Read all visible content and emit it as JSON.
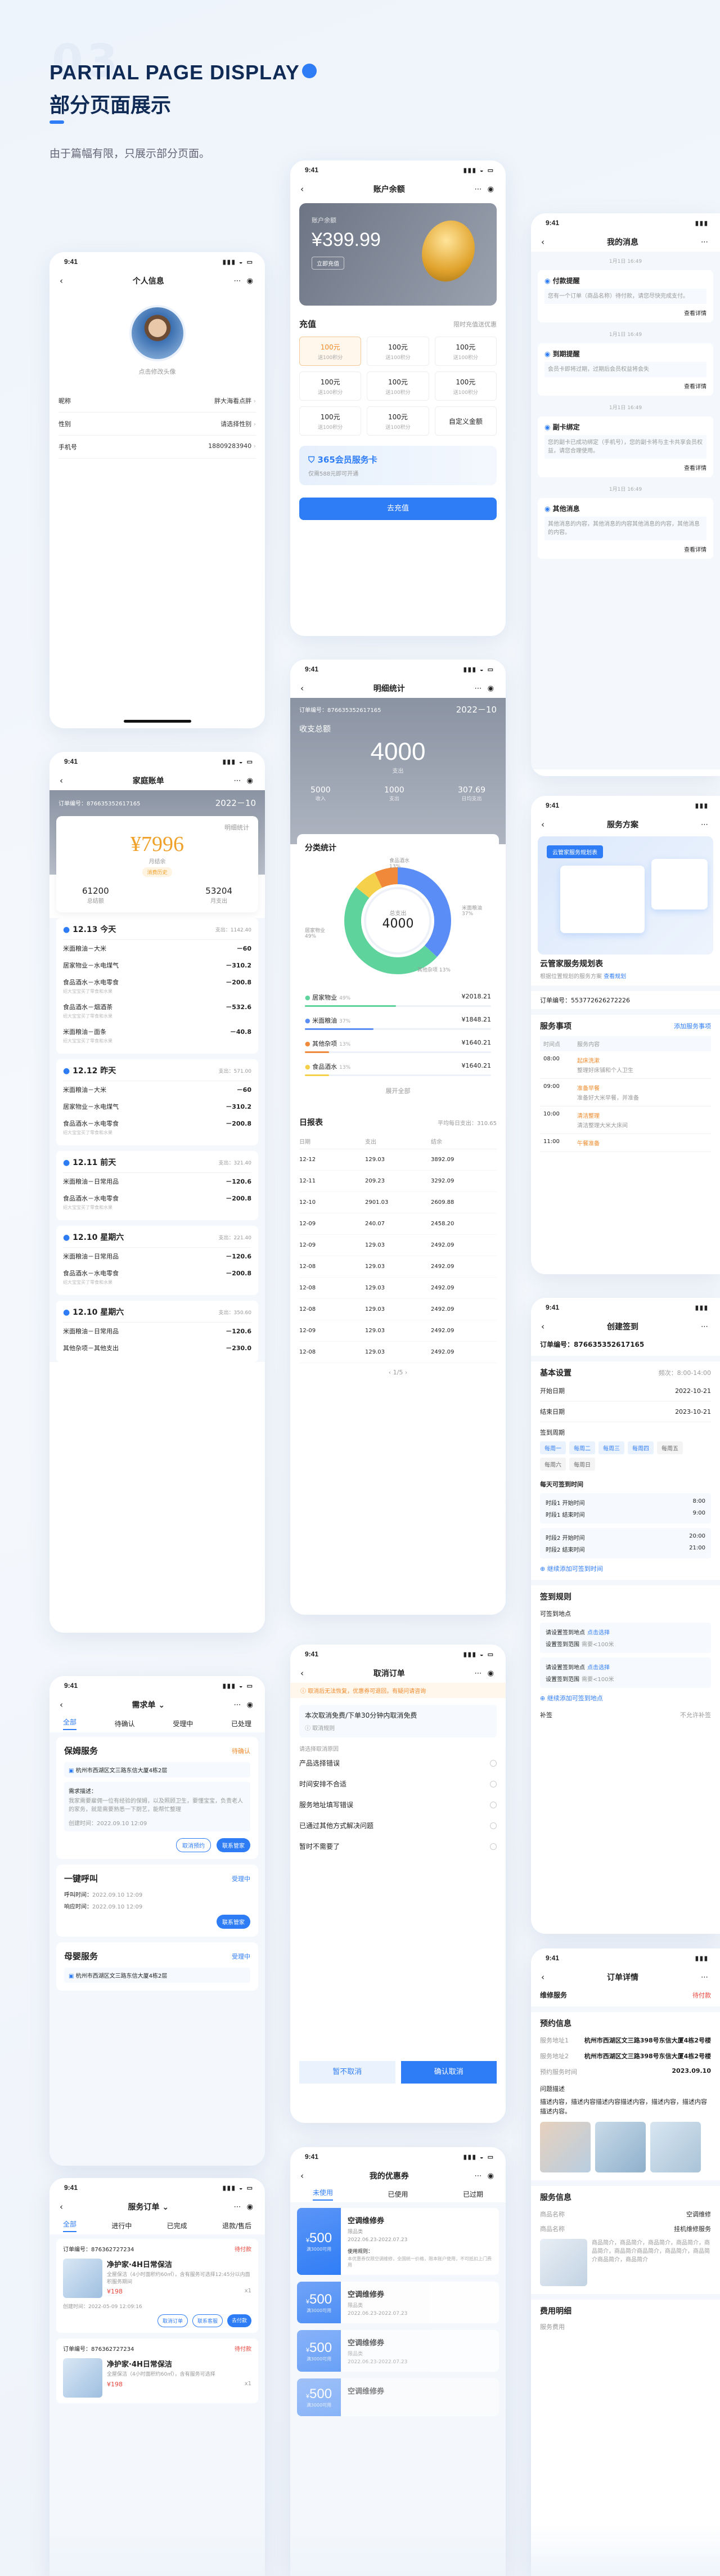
{
  "header": {
    "ghost": "03",
    "title_en": "PARTIAL PAGE DISPLAY",
    "title_cn": "部分页面展示",
    "desc": "由于篇幅有限，只展示部分页面。"
  },
  "status_time": "9:41",
  "profile": {
    "title": "个人信息",
    "avatar_hint": "点击修改头像",
    "rows": [
      {
        "label": "昵称",
        "value": "胖大海看点胖"
      },
      {
        "label": "性别",
        "value": "请选择性别"
      },
      {
        "label": "手机号",
        "value": "18809283940"
      }
    ]
  },
  "balance": {
    "title": "账户余额",
    "card_label": "账户余额",
    "amount": "¥399.99",
    "card_btn": "立即充值",
    "recharge_title": "充值",
    "recharge_hint": "限时充值送优惠",
    "options": [
      {
        "a": "100元",
        "b": "送100积分"
      },
      {
        "a": "100元",
        "b": "送100积分"
      },
      {
        "a": "100元",
        "b": "送100积分"
      },
      {
        "a": "100元",
        "b": "送100积分"
      },
      {
        "a": "100元",
        "b": "送100积分"
      },
      {
        "a": "100元",
        "b": "送100积分"
      },
      {
        "a": "100元",
        "b": "送100积分"
      },
      {
        "a": "100元",
        "b": "送100积分"
      },
      {
        "a": "自定义金额",
        "b": ""
      }
    ],
    "vip_title": "365会员服务卡",
    "vip_sub": "仅需588元即可开通",
    "submit": "去充值"
  },
  "messages": {
    "title": "我的消息",
    "items": [
      {
        "time": "1月1日 16:49",
        "title": "付款提醒",
        "body": "您有一个订单（商品名称）待付款，请您尽快完成支付。",
        "link": "查看详情"
      },
      {
        "time": "1月1日 16:49",
        "title": "到期提醒",
        "body": "会员卡即将过期，过期后会员权益将会失",
        "link": "查看详情"
      },
      {
        "time": "1月1日 16:49",
        "title": "副卡绑定",
        "body": "您的副卡已成功绑定（手机号），您的副卡将与主卡共享会员权益，请您合理使用。",
        "link": "查看详情"
      },
      {
        "time": "1月1日 16:49",
        "title": "其他消息",
        "body": "其他消息的内容，其他消息的内容其他消息的内容，其他消息的内容。",
        "link": "查看详情"
      }
    ]
  },
  "stats": {
    "title": "明细统计",
    "order_no": "订单编号：876635352617165",
    "month": "2022－10",
    "total_label": "收支总额",
    "total": "4000",
    "total_unit": "支出",
    "sub": [
      {
        "v": "5000",
        "l": "收入"
      },
      {
        "v": "1000",
        "l": "支出"
      },
      {
        "v": "307.69",
        "l": "日均支出"
      }
    ],
    "cat_title": "分类统计",
    "donut_center": "4000",
    "donut_center_label": "总支出",
    "donut_labels": [
      "食品酒水 13%",
      "米面粮油 37%",
      "其他杂项 13%",
      "居家物业 49%"
    ],
    "cats": [
      {
        "name": "居家物业",
        "pct": "49%",
        "amt": "¥2018.21"
      },
      {
        "name": "米面粮油",
        "pct": "37%",
        "amt": "¥1848.21"
      },
      {
        "name": "其他杂项",
        "pct": "13%",
        "amt": "¥1640.21"
      },
      {
        "name": "食品酒水",
        "pct": "13%",
        "amt": "¥1640.21"
      }
    ],
    "expand": "展开全部",
    "daily_title": "日报表",
    "daily_hint": "平均每日支出：310.65",
    "daily_head": [
      "日期",
      "支出",
      "结余"
    ],
    "daily": [
      [
        "12-12",
        "129.03",
        "3892.09"
      ],
      [
        "12-11",
        "209.23",
        "3292.09"
      ],
      [
        "12-10",
        "2901.03",
        "2609.88"
      ],
      [
        "12-09",
        "240.07",
        "2458.20"
      ],
      [
        "12-09",
        "129.03",
        "2492.09"
      ],
      [
        "12-08",
        "129.03",
        "2492.09"
      ],
      [
        "12-08",
        "129.03",
        "2492.09"
      ],
      [
        "12-08",
        "129.03",
        "2492.09"
      ],
      [
        "12-09",
        "129.03",
        "2492.09"
      ],
      [
        "12-08",
        "129.03",
        "2492.09"
      ]
    ],
    "pager": "1/5"
  },
  "service": {
    "title": "服务方案",
    "banner_title": "云管家服务规划表",
    "plan_title": "云管家服务规划表",
    "plan_sub": "根据位置规划的服务方案",
    "plan_link": "查看规划",
    "order": "订单编号：553772626272226",
    "items_title": "服务事项",
    "add": "添加服务事项",
    "head": [
      "时间点",
      "服务内容"
    ],
    "rows": [
      {
        "t": "08:00",
        "d": "起床洗漱",
        "s": "整理好床铺和个人卫生"
      },
      {
        "t": "09:00",
        "d": "准备早餐",
        "s": "准备好大米早餐，并准备"
      },
      {
        "t": "10:00",
        "d": "清洁整理",
        "s": "清洁整理大米大床间"
      },
      {
        "t": "11:00",
        "d": "午餐准备",
        "s": ""
      }
    ]
  },
  "ledger": {
    "title": "家庭账单",
    "order_no": "订单编号：876635352617165",
    "month": "2022－10",
    "detail": "明细统计",
    "amount": "¥7996",
    "amount_label": "月结余",
    "chip": "消费历史",
    "income": "61200",
    "income_l": "总结额",
    "expense": "53204",
    "expense_l": "月支出",
    "days": [
      {
        "date": "12.13 今天",
        "total": "支出：1142.40",
        "items": [
          {
            "n": "米面粮油－大米",
            "a": "－60",
            "s": ""
          },
          {
            "n": "居家物业－水电煤气",
            "a": "－310.2",
            "s": ""
          },
          {
            "n": "食品酒水－水电零食",
            "a": "－200.8",
            "s": "绍大宝宝买了零食和水果"
          },
          {
            "n": "食品酒水－烟酒茶",
            "a": "－532.6",
            "s": "绍大宝宝买了零食和水果"
          },
          {
            "n": "米面粮油－面条",
            "a": "－40.8",
            "s": "绍大宝宝买了零食和水果"
          }
        ]
      },
      {
        "date": "12.12 昨天",
        "total": "支出：571.00",
        "items": [
          {
            "n": "米面粮油－大米",
            "a": "－60",
            "s": ""
          },
          {
            "n": "居家物业－水电煤气",
            "a": "－310.2",
            "s": ""
          },
          {
            "n": "食品酒水－水电零食",
            "a": "－200.8",
            "s": "绍大宝宝买了零食和水果"
          }
        ]
      },
      {
        "date": "12.11 前天",
        "total": "支出：321.40",
        "items": [
          {
            "n": "米面粮油－日常用品",
            "a": "－120.6",
            "s": ""
          },
          {
            "n": "食品酒水－水电零食",
            "a": "－200.8",
            "s": "绍大宝宝买了零食和水果"
          }
        ]
      },
      {
        "date": "12.10 星期六",
        "total": "支出：221.40",
        "items": [
          {
            "n": "米面粮油－日常用品",
            "a": "－120.6",
            "s": ""
          },
          {
            "n": "食品酒水－水电零食",
            "a": "－200.8",
            "s": "绍大宝宝买了零食和水果"
          }
        ]
      },
      {
        "date": "12.10 星期六",
        "total": "支出：350.60",
        "items": [
          {
            "n": "米面粮油－日常用品",
            "a": "－120.6",
            "s": ""
          },
          {
            "n": "其他杂项－其他支出",
            "a": "－230.0",
            "s": ""
          }
        ]
      }
    ]
  },
  "cancel": {
    "title": "取消订单",
    "notice": "取消后无法恢复，优惠券可退回，有疑问请咨询",
    "rule": "本次取消免费/下单30分钟内取消免费",
    "rule_link": "取消规则",
    "reason_title": "请选择取消原因",
    "reasons": [
      "产品选择错误",
      "时间安排不合适",
      "服务地址填写错误",
      "已通过其他方式解决问题",
      "暂时不需要了"
    ],
    "btn_no": "暂不取消",
    "btn_yes": "确认取消"
  },
  "checkin": {
    "title": "创建签到",
    "order": "订单编号：876635352617165",
    "basic": "基本设置",
    "freq": "频次：8:00-14:00",
    "start_label": "开始日期",
    "start": "2022-10-21",
    "end_label": "结束日期",
    "end": "2023-10-21",
    "cycle_label": "签到周期",
    "days": [
      "每周一",
      "每周二",
      "每周三",
      "每周四",
      "每周五",
      "每周六",
      "每周日"
    ],
    "slot_label": "每天可签到时间",
    "slots": [
      {
        "a": "时段1 开始时间",
        "av": "8:00",
        "b": "时段1 结束时间",
        "bv": "9:00"
      },
      {
        "a": "时段2 开始时间",
        "av": "20:00",
        "b": "时段2 结束时间",
        "bv": "21:00"
      }
    ],
    "add_slot": "继续添加可签到时间",
    "rules": "签到规则",
    "loc_label": "可签到地点",
    "locs": [
      {
        "t": "请设置签到地点",
        "l": "点击选择",
        "s": "设置签到范围",
        "r": "需要<100米"
      },
      {
        "t": "请设置签到地点",
        "l": "点击选择",
        "s": "设置签到范围",
        "r": "需要<100米"
      }
    ],
    "add_loc": "继续添加可签到地点",
    "remark": "补签",
    "remark_v": "不允许补签"
  },
  "demand": {
    "title": "需求单",
    "tabs": [
      "全部",
      "待确认",
      "受理中",
      "已处理"
    ],
    "cards": [
      {
        "t": "保姆服务",
        "st": "待确认",
        "addr": "杭州市西湖区文三路东信大厦4栋2层",
        "need_l": "需求描述：",
        "need": "我家需要雇佣一位有经验的保姆，以及照顾卫生，要懂宝宝，负责老人的家务，就是需要熟悉一下厨艺，能帮忙整理",
        "time_l": "创建时间：",
        "time": "2022.09.10 12:09",
        "b1": "取消预约",
        "b2": "联系管家"
      },
      {
        "t": "一键呼叫",
        "st": "受理中",
        "a1": "呼叫时间：",
        "v1": "2022.09.10 12:09",
        "a2": "响应时间：",
        "v2": "2022.09.10 12:09",
        "b2": "联系管家"
      },
      {
        "t": "母婴服务",
        "st": "受理中",
        "addr": "杭州市西湖区文三路东信大厦4栋2层"
      }
    ]
  },
  "coupons": {
    "title": "我的优惠券",
    "tabs": [
      "未使用",
      "已使用",
      "已过期"
    ],
    "items": [
      {
        "v": "500",
        "c": "满3000可用",
        "n": "空调维修券",
        "s": "限品类",
        "d": "2022.06.23-2022.07.23",
        "rule": "使用规则：",
        "rtext": "本优惠券仅限空调维修，全国统一价格，限本账户使用，不可抵扣上门费用"
      },
      {
        "v": "500",
        "c": "满3000可用",
        "n": "空调维修券",
        "s": "限品类",
        "d": "2022.06.23-2022.07.23"
      },
      {
        "v": "500",
        "c": "满3000可用",
        "n": "空调维修券",
        "s": "限品类",
        "d": "2022.06.23-2022.07.23"
      },
      {
        "v": "500",
        "c": "满3000可用",
        "n": "空调维修券",
        "s": "",
        "d": ""
      }
    ]
  },
  "orders": {
    "title": "服务订单",
    "tabs": [
      "全部",
      "进行中",
      "已完成",
      "退款/售后"
    ],
    "items": [
      {
        "no": "订单编号：876362727234",
        "st": "待付款",
        "n": "净护家·4H日常保洁",
        "d": "全屋保洁（4小时面积约60㎡），含有服务可选择12:45分以内面积服务期间",
        "p": "¥198",
        "q": "x1",
        "time": "创建时间：2022-05-09 12:09:16",
        "b": [
          "取消订单",
          "联系客服",
          "去付款"
        ]
      },
      {
        "no": "订单编号：876362727234",
        "st": "待付款",
        "n": "净护家·4H日常保洁",
        "d": "全屋保洁（4小时面积约60㎡），含有服务可选择",
        "p": "¥198",
        "q": "x1",
        "time": "",
        "b": []
      }
    ]
  },
  "detail": {
    "title": "订单详情",
    "svc": "维修服务",
    "st": "待付款",
    "info": "预约信息",
    "rows": [
      {
        "l": "服务地址1",
        "v": "杭州市西湖区文三路398号东信大厦4栋2号楼"
      },
      {
        "l": "服务地址2",
        "v": "杭州市西湖区文三路398号东信大厦4栋2号楼"
      },
      {
        "l": "预约服务时间",
        "v": "2023.09.10"
      }
    ],
    "q": "问题描述",
    "qtext": "描述内容，描述内容描述内容描述内容，描述内容，描述内容描述内容。",
    "svc_info": "服务信息",
    "name_l": "商品名称",
    "name": "空调维修",
    "title_l": "商品名称",
    "title2": "挂机维修服务",
    "desc": "商品简介，商品简介，商品简介，商品简介，商品简介，商品简介商品简介，商品简介，商品简介商品简介，商品简介",
    "fee": "费用明细",
    "fee_l": "服务费用"
  }
}
